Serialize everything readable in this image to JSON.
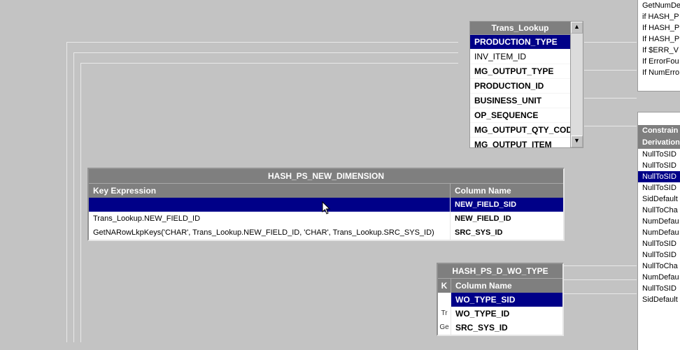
{
  "trans_lookup": {
    "title": "Trans_Lookup",
    "items": [
      {
        "label": "PRODUCTION_TYPE",
        "selected": true,
        "bold": true
      },
      {
        "label": "INV_ITEM_ID",
        "selected": false,
        "bold": false
      },
      {
        "label": "MG_OUTPUT_TYPE",
        "selected": false,
        "bold": true
      },
      {
        "label": "PRODUCTION_ID",
        "selected": false,
        "bold": true
      },
      {
        "label": "BUSINESS_UNIT",
        "selected": false,
        "bold": true
      },
      {
        "label": "OP_SEQUENCE",
        "selected": false,
        "bold": true
      },
      {
        "label": "MG_OUTPUT_QTY_COD",
        "selected": false,
        "bold": true
      },
      {
        "label": "MG_OUTPUT_ITEM",
        "selected": false,
        "bold": true
      }
    ]
  },
  "hash_new_dim": {
    "title": "HASH_PS_NEW_DIMENSION",
    "col_key": "Key Expression",
    "col_name": "Column Name",
    "rows": [
      {
        "key": "",
        "col": "NEW_FIELD_SID",
        "selected": true
      },
      {
        "key": "Trans_Lookup.NEW_FIELD_ID",
        "col": "NEW_FIELD_ID",
        "selected": false
      },
      {
        "key": "GetNARowLkpKeys('CHAR', Trans_Lookup.NEW_FIELD_ID, 'CHAR', Trans_Lookup.SRC_SYS_ID)",
        "col": "SRC_SYS_ID",
        "selected": false
      }
    ]
  },
  "wo_type": {
    "title": "HASH_PS_D_WO_TYPE",
    "col_key_short": "K",
    "col_name": "Column Name",
    "rows": [
      {
        "k": "",
        "col": "WO_TYPE_SID",
        "selected": true
      },
      {
        "k": "Tr",
        "col": "WO_TYPE_ID",
        "selected": false
      },
      {
        "k": "Ge",
        "col": "SRC_SYS_ID",
        "selected": false
      }
    ]
  },
  "right_top": {
    "rows": [
      "GetNumDe",
      "if HASH_P",
      "If HASH_P",
      "If HASH_P",
      "If $ERR_V",
      "If ErrorFou",
      "If NumErro"
    ]
  },
  "right_bottom": {
    "hdr1": "Constrain",
    "hdr2": "Derivation",
    "rows": [
      {
        "label": "NullToSID",
        "selected": false
      },
      {
        "label": "NullToSID",
        "selected": false
      },
      {
        "label": "NullToSID",
        "selected": true
      },
      {
        "label": "NullToSID",
        "selected": false
      },
      {
        "label": "SidDefault",
        "selected": false
      },
      {
        "label": "NullToCha",
        "selected": false
      },
      {
        "label": "NumDefau",
        "selected": false
      },
      {
        "label": "NumDefau",
        "selected": false
      },
      {
        "label": "NullToSID",
        "selected": false
      },
      {
        "label": "NullToSID",
        "selected": false
      },
      {
        "label": "NullToCha",
        "selected": false
      },
      {
        "label": "NumDefau",
        "selected": false
      },
      {
        "label": "NullToSID",
        "selected": false
      },
      {
        "label": "SidDefault",
        "selected": false
      }
    ]
  },
  "scroll": {
    "up": "▲",
    "down": "▼"
  }
}
